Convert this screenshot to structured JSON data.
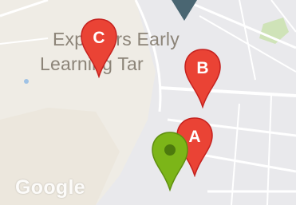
{
  "map": {
    "poi_label": {
      "line1": "Explorers Early",
      "line2": "Learning Tar"
    },
    "markers": [
      {
        "id": "C",
        "letter": "C",
        "color": "#ea4335"
      },
      {
        "id": "B",
        "letter": "B",
        "color": "#ea4335"
      },
      {
        "id": "A",
        "letter": "A",
        "color": "#ea4335"
      },
      {
        "id": "green",
        "letter": "",
        "color": "#7cb518"
      }
    ],
    "watermark": "Google",
    "colors": {
      "land": "#efece5",
      "urban": "#e8e8ea",
      "road": "#ffffff",
      "water": "#9fc2e5",
      "park": "#c8dfb0",
      "top_marker": "#4a6672"
    }
  }
}
